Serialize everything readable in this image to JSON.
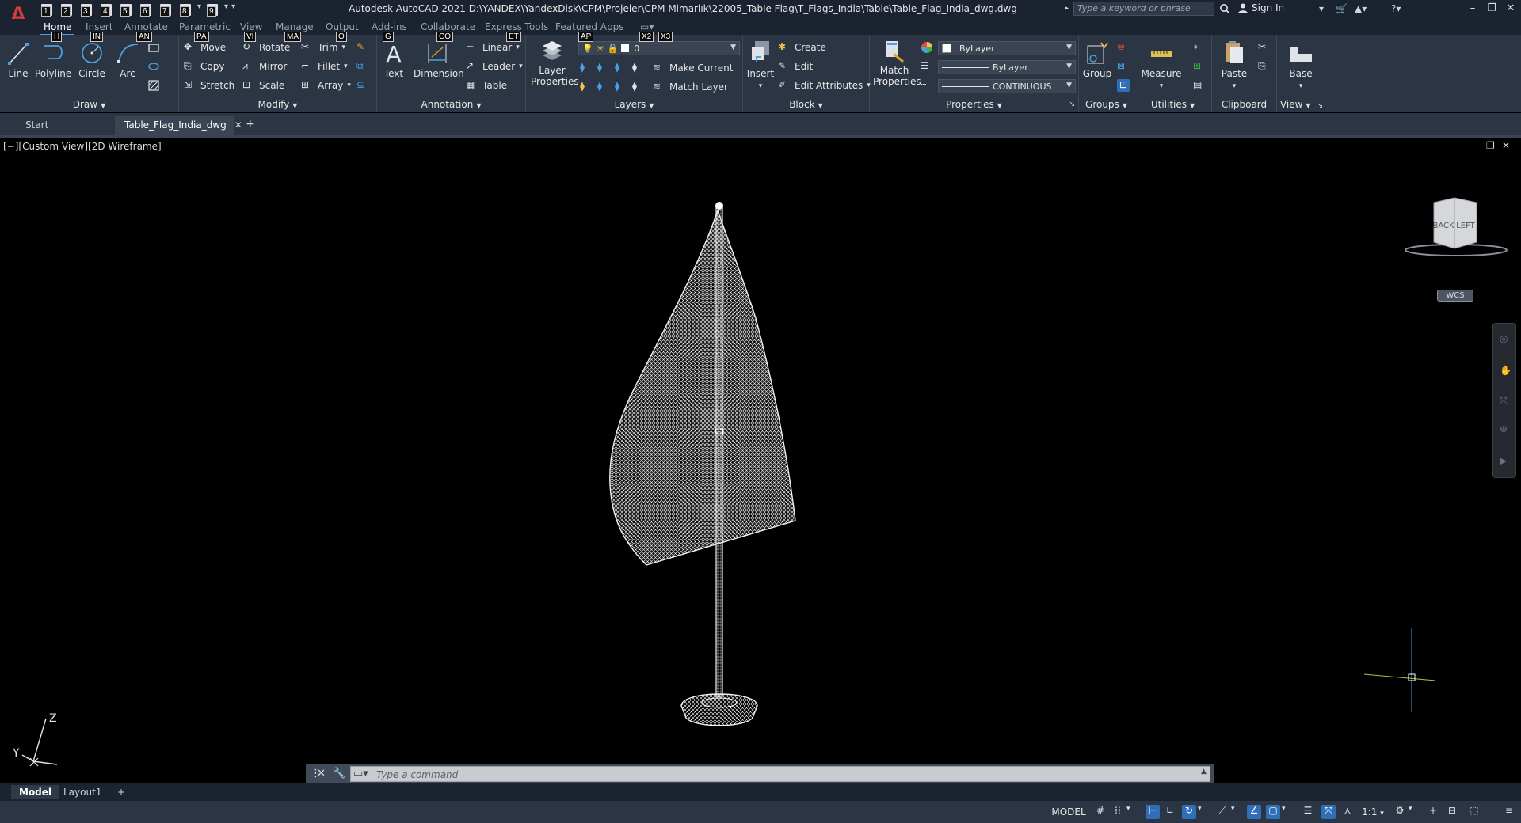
{
  "app": {
    "title": "Autodesk AutoCAD 2021   D:\\YANDEX\\YandexDisk\\CPM\\Projeler\\CPM Mimarlık\\22005_Table Flag\\T_Flags_India\\Table\\Table_Flag_India_dwg.dwg",
    "logo": "A",
    "search_placeholder": "Type a keyword or phrase",
    "signin": "Sign In"
  },
  "qat_keytips": [
    "1",
    "2",
    "3",
    "4",
    "5",
    "6",
    "7",
    "8",
    "9"
  ],
  "ribbon_tabs": [
    {
      "label": "Home",
      "keytip": "H",
      "active": true
    },
    {
      "label": "Insert",
      "keytip": "IN"
    },
    {
      "label": "Annotate",
      "keytip": "AN"
    },
    {
      "label": "Parametric",
      "keytip": "PA"
    },
    {
      "label": "View",
      "keytip": "VI"
    },
    {
      "label": "Manage",
      "keytip": "MA"
    },
    {
      "label": "Output",
      "keytip": "O"
    },
    {
      "label": "Add-ins",
      "keytip": ""
    },
    {
      "label": "Collaborate",
      "keytip": ""
    },
    {
      "label": "Express Tools",
      "keytip": "ET"
    },
    {
      "label": "Featured Apps",
      "keytip": ""
    }
  ],
  "extra_keytips": {
    "g": "G",
    "co": "CO",
    "ap": "AP",
    "x2": "X2",
    "x3": "X3"
  },
  "draw": {
    "label": "Draw",
    "line": "Line",
    "polyline": "Polyline",
    "circle": "Circle",
    "arc": "Arc"
  },
  "modify": {
    "label": "Modify",
    "move": "Move",
    "rotate": "Rotate",
    "trim": "Trim",
    "copy": "Copy",
    "mirror": "Mirror",
    "fillet": "Fillet",
    "stretch": "Stretch",
    "scale": "Scale",
    "array": "Array"
  },
  "annotation": {
    "label": "Annotation",
    "text": "Text",
    "dimension": "Dimension",
    "linear": "Linear",
    "leader": "Leader",
    "table": "Table"
  },
  "layers": {
    "label": "Layers",
    "layer_properties_1": "Layer",
    "layer_properties_2": "Properties",
    "current_layer": "0",
    "make_current": "Make Current",
    "match_layer": "Match Layer"
  },
  "block": {
    "label": "Block",
    "insert": "Insert",
    "create": "Create",
    "edit": "Edit",
    "edit_attributes": "Edit Attributes"
  },
  "properties": {
    "label": "Properties",
    "match_1": "Match",
    "match_2": "Properties",
    "color": "ByLayer",
    "lineweight": "ByLayer",
    "linetype": "CONTINUOUS"
  },
  "groups": {
    "label": "Groups",
    "group": "Group"
  },
  "utilities": {
    "label": "Utilities",
    "measure": "Measure"
  },
  "clipboard": {
    "label": "Clipboard",
    "paste": "Paste"
  },
  "view": {
    "label": "View",
    "base": "Base"
  },
  "file_tabs": [
    {
      "label": "Start"
    },
    {
      "label": "Table_Flag_India_dwg",
      "active": true
    }
  ],
  "viewport": {
    "label": "[−][Custom View][2D Wireframe]",
    "viewcube_back": "BACK",
    "viewcube_left": "LEFT",
    "wcs": "WCS",
    "ucs_z": "Z",
    "ucs_y": "Y"
  },
  "command": {
    "placeholder": "Type a command"
  },
  "layout_tabs": [
    {
      "label": "Model",
      "active": true
    },
    {
      "label": "Layout1"
    }
  ],
  "status": {
    "model": "MODEL",
    "scale": "1:1"
  },
  "colors": {
    "accent": "#4b9fe3",
    "ribbon_bg": "#2c3543",
    "title_bg": "#1b2330",
    "logo_red": "#d83b3b"
  }
}
